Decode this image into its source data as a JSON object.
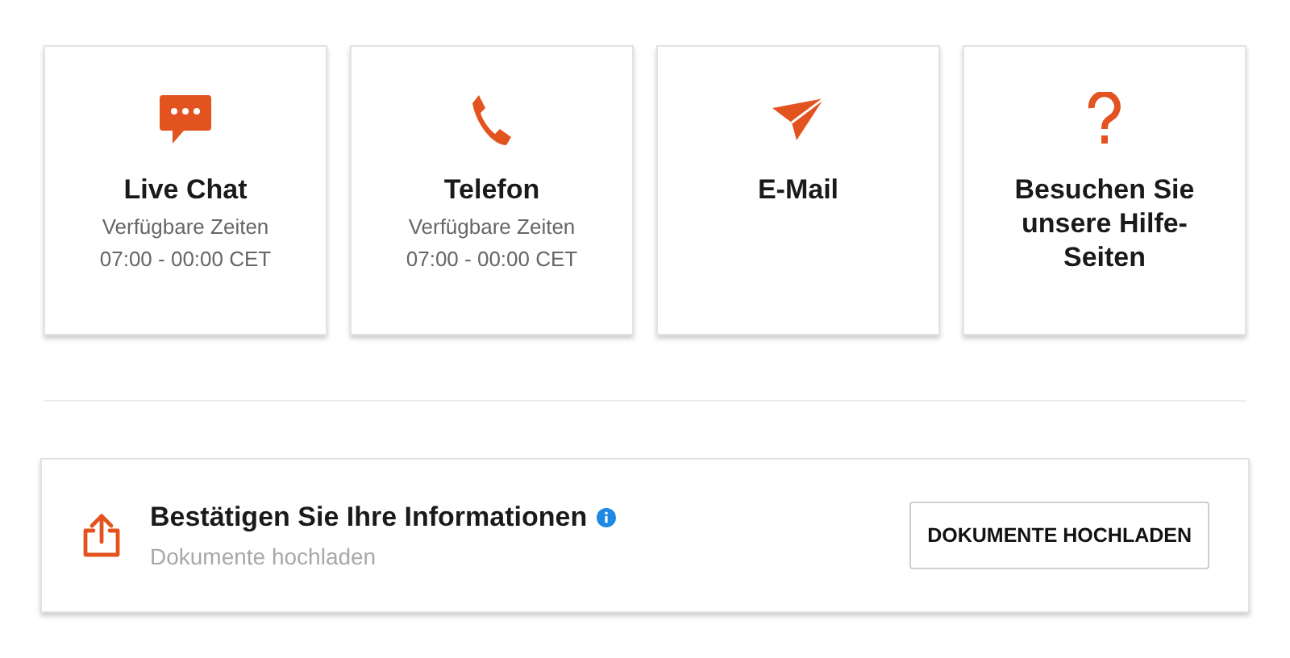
{
  "contact_cards": [
    {
      "kind": "chat",
      "title": "Live Chat",
      "lines": [
        "Verfügbare Zeiten",
        "07:00 - 00:00 CET"
      ]
    },
    {
      "kind": "phone",
      "title": "Telefon",
      "lines": [
        "Verfügbare Zeiten",
        "07:00 - 00:00 CET"
      ]
    },
    {
      "kind": "email",
      "title": "E-Mail"
    },
    {
      "kind": "help",
      "title": "Besuchen Sie unsere Hilfe-Seiten"
    }
  ],
  "verify_panel": {
    "title": "Bestätigen Sie Ihre Informationen",
    "subtitle": "Dokumente hochladen",
    "button": "DOKUMENTE HOCHLADEN"
  }
}
